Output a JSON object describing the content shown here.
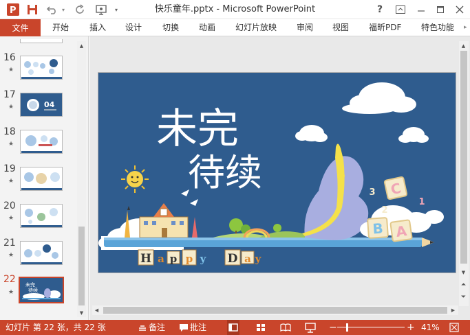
{
  "window": {
    "title": "快乐童年.pptx - Microsoft PowerPoint",
    "help": "?"
  },
  "ribbon": {
    "tabs": [
      "文件",
      "开始",
      "插入",
      "设计",
      "切换",
      "动画",
      "幻灯片放映",
      "审阅",
      "视图",
      "福昕PDF",
      "特色功能"
    ]
  },
  "thumbnails": {
    "items": [
      {
        "num": "16",
        "selected": false
      },
      {
        "num": "17",
        "selected": false,
        "text": "04"
      },
      {
        "num": "18",
        "selected": false
      },
      {
        "num": "19",
        "selected": false
      },
      {
        "num": "20",
        "selected": false
      },
      {
        "num": "21",
        "selected": false
      },
      {
        "num": "22",
        "selected": true
      }
    ],
    "star": "★"
  },
  "slide": {
    "title_line1": "未完",
    "title_line2": "待续",
    "letters_left": [
      "H",
      "a",
      "p",
      "p",
      "y"
    ],
    "letters_right": [
      "D",
      "a",
      "y"
    ],
    "blocks": [
      "C",
      "A",
      "B"
    ],
    "numbers": [
      "3",
      "1",
      "2"
    ]
  },
  "status": {
    "slide_info": "幻灯片 第 22 张，共 22 张",
    "notes": "备注",
    "comments": "批注",
    "zoom": "41%",
    "minus": "−",
    "plus": "+"
  },
  "colors": {
    "accent": "#c9452b",
    "slide_bg": "#2f5c8e",
    "dino": "#a8aee0",
    "pencil": "#5aa4d8"
  }
}
